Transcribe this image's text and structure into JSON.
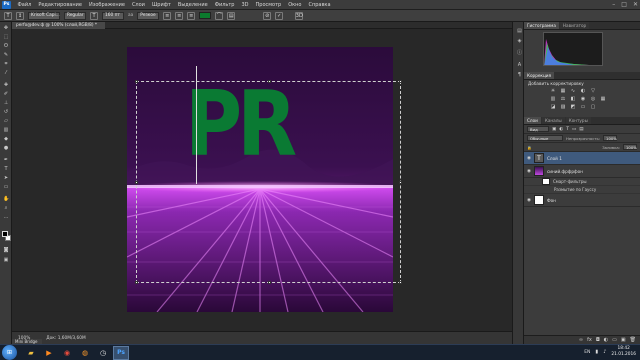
{
  "menubar": {
    "logo": "Ps",
    "items": [
      "Файл",
      "Редактирование",
      "Изображение",
      "Слои",
      "Шрифт",
      "Выделение",
      "Фильтр",
      "3D",
      "Просмотр",
      "Окно",
      "Справка"
    ],
    "window_controls": [
      "–",
      "□",
      "✕"
    ]
  },
  "options_bar": {
    "font_family": "Krisoft Capi...",
    "font_style": "Regular",
    "font_size": "160 пт",
    "antialias": "Резкое",
    "color_hex": "#0b7a2d"
  },
  "document": {
    "tab_title": "perfo@dev.ф @ 100% (слой,RGB/8) *",
    "canvas_text": "PR"
  },
  "status": {
    "zoom": "100%",
    "doc_info": "Док: 1,60М/3,60М",
    "mini_bridge": "Mini Bridge"
  },
  "panels": {
    "top_tabs": [
      "Гистограмма",
      "Навигатор"
    ],
    "adjust_tabs": [
      "Коррекция"
    ],
    "adjust_title": "Добавить корректировку",
    "layer_tabs": [
      "Слои",
      "Каналы",
      "Контуры"
    ],
    "filter_label": "Вид",
    "blend_mode": "Обычные",
    "opacity_label": "Непрозрачность:",
    "opacity_value": "100%",
    "fill_label": "Заливка:",
    "fill_value": "100%",
    "layers": [
      {
        "name": "Слой 1",
        "kind": "text"
      },
      {
        "name": "синий.фрфрфон",
        "kind": "smart"
      },
      {
        "name": "Смарт-фильтры",
        "kind": "sub"
      },
      {
        "name": "Размытие по Гауссу",
        "kind": "sub"
      },
      {
        "name": "Фон",
        "kind": "bg"
      }
    ]
  },
  "taskbar": {
    "apps": [
      "folder",
      "media",
      "chrome",
      "firefox",
      "clock",
      "photoshop"
    ],
    "language": "EN",
    "time": "18:42",
    "date": "21.01.2016"
  }
}
